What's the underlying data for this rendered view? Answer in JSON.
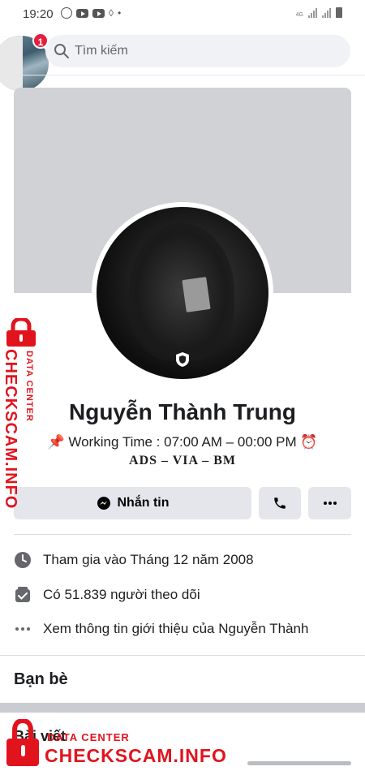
{
  "status_bar": {
    "time": "19:20",
    "network_label": "4G"
  },
  "header": {
    "search_placeholder": "Tìm kiếm",
    "notification_count": "1"
  },
  "profile": {
    "name": "Nguyễn Thành Trung",
    "bio_line1": "📌 Working Time : 07:00 AM – 00:00 PM ⏰",
    "bio_line2": "ADS – VIA – BM"
  },
  "actions": {
    "message_label": "Nhắn tin"
  },
  "intro": {
    "joined": "Tham gia vào Tháng 12 năm 2008",
    "followers": "Có 51.839 người theo dõi",
    "see_more": "Xem thông tin giới thiệu của Nguyễn Thành"
  },
  "sections": {
    "friends": "Bạn bè",
    "posts": "Bài viết"
  },
  "watermark": {
    "small_text": "DATA CENTER",
    "main_text": "CHECKSCAM.INFO"
  },
  "colors": {
    "watermark_red": "#e1141e",
    "badge_red": "#e41e3f",
    "button_gray": "#e4e6eb"
  }
}
